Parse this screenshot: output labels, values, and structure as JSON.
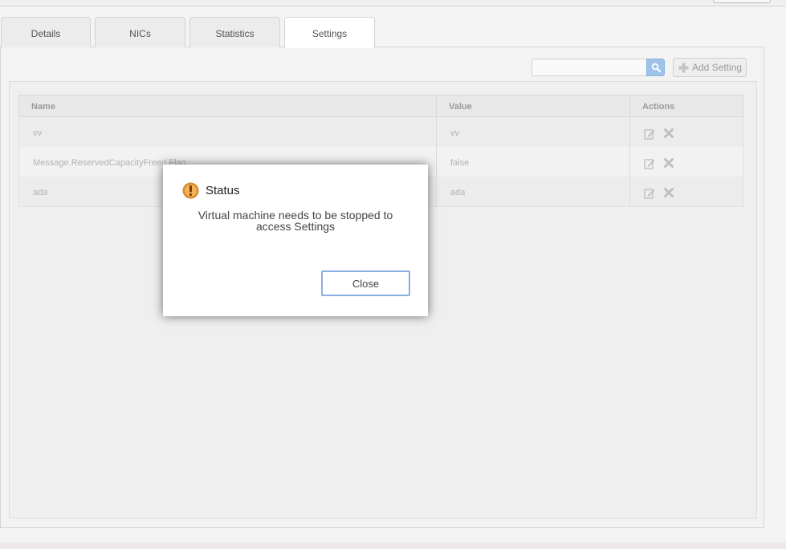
{
  "tabs": [
    {
      "label": "Details",
      "active": false
    },
    {
      "label": "NICs",
      "active": false
    },
    {
      "label": "Statistics",
      "active": false
    },
    {
      "label": "Settings",
      "active": true
    }
  ],
  "toolbar": {
    "search_placeholder": "",
    "search_icon": "search-icon",
    "add_label": "Add Setting",
    "add_icon": "plus-icon"
  },
  "table": {
    "columns": [
      "Name",
      "Value",
      "Actions"
    ],
    "rows": [
      {
        "name": "vv",
        "value": "vv"
      },
      {
        "name": "Message.ReservedCapacityFreed.Flag",
        "value": "false"
      },
      {
        "name": "ada",
        "value": "ada"
      }
    ],
    "action_icons": [
      "edit-icon",
      "delete-icon"
    ]
  },
  "dialog": {
    "icon": "warning-icon",
    "title": "Status",
    "message": "Virtual machine needs to be stopped to access Settings",
    "close_label": "Close"
  },
  "colors": {
    "accent": "#89aee0",
    "warning_icon": "#d98a2b",
    "search_button": "#9fc3e8"
  }
}
